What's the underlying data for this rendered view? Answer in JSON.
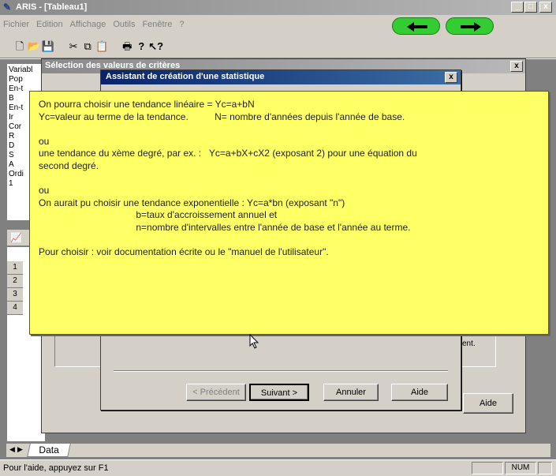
{
  "window": {
    "title": "ARIS - [Tableau1]",
    "minimize": "_",
    "maximize": "□",
    "close": "x"
  },
  "menu": [
    "Fichier",
    "Edition",
    "Affichage",
    "Outils",
    "Fenêtre",
    "?"
  ],
  "nav": {
    "back_icon": "arrow-left",
    "forward_icon": "arrow-right",
    "color": "#33cc33"
  },
  "toolbar_icons": [
    "new-icon",
    "open-icon",
    "save-icon",
    "cut-icon",
    "copy-icon",
    "paste-icon",
    "print-icon",
    "help-icon",
    "context-help-icon"
  ],
  "left_panel": {
    "lines": [
      "Variabl",
      "Pop",
      "En-t",
      "B",
      "En-t",
      "Ir",
      "Cor",
      "R",
      "D",
      "S",
      "A",
      "Ordi",
      "1"
    ]
  },
  "row_numbers": [
    "1",
    "2",
    "3",
    "4"
  ],
  "dialog_back": {
    "title": "Sélection des valeurs de critères",
    "close": "x",
    "aide_label": "Aide",
    "partial_text": "ent."
  },
  "dialog_front": {
    "title": "Assistant de création d'une statistique",
    "close": "x",
    "buttons": {
      "prev": "< Précédent",
      "next": "Suivant >",
      "cancel": "Annuler",
      "help": "Aide"
    }
  },
  "note": {
    "bg": "#ffff66",
    "lines": [
      "On pourra choisir une tendance linéaire = Yc=a+bN",
      "Yc=valeur au terme de la tendance.          N= nombre d'années depuis l'année de base.",
      "",
      "ou",
      "une tendance du xème degré, par ex. :   Yc=a+bX+cX2 (exposant 2) pour une équation du",
      "second degré.",
      "",
      "ou",
      "On aurait pu choisir une tendance exponentielle : Yc=a*bn (exposant \"n\")",
      "                                     b=taux d'accroissement annuel et",
      "                                     n=nombre d'intervalles entre l'année de base et l'année au terme.",
      "",
      "Pour choisir : voir documentation écrite ou le \"manuel de l'utilisateur\"."
    ]
  },
  "sheet_tab": "Data",
  "status": {
    "help": "Pour l'aide, appuyez sur F1",
    "num": "NUM"
  }
}
